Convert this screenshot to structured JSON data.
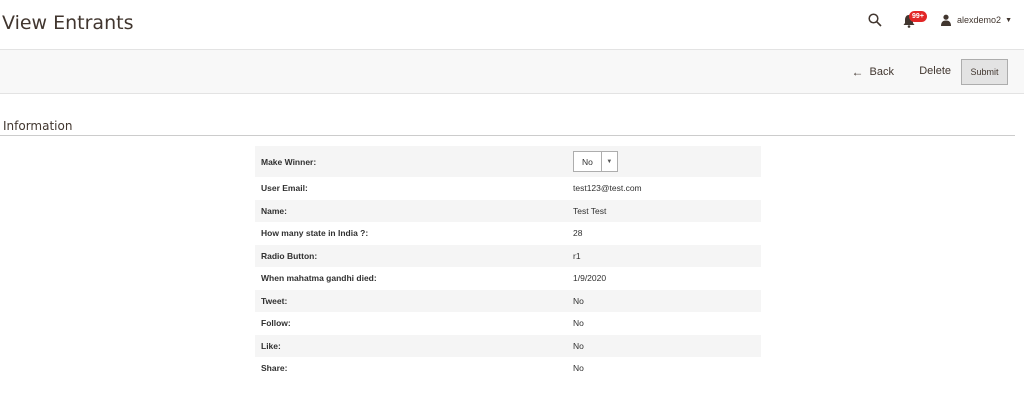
{
  "header": {
    "title": "View Entrants",
    "notification_count": "99+",
    "username": "alexdemo2",
    "icons": [
      "search-icon",
      "bell-icon",
      "user-icon",
      "caret-down-icon"
    ]
  },
  "actions": {
    "back_label": "Back",
    "delete_label": "Delete",
    "submit_label": "Submit"
  },
  "section": {
    "title": "Information"
  },
  "fields": {
    "make_winner": {
      "label": "Make Winner:",
      "value": "No",
      "options_visible": [
        "No"
      ]
    },
    "rows": [
      {
        "label": "User Email:",
        "value": "test123@test.com"
      },
      {
        "label": "Name:",
        "value": "Test Test"
      },
      {
        "label": "How many state in India ?:",
        "value": "28"
      },
      {
        "label": "Radio Button:",
        "value": "r1"
      },
      {
        "label": "When mahatma gandhi died:",
        "value": "1/9/2020"
      },
      {
        "label": "Tweet:",
        "value": "No"
      },
      {
        "label": "Follow:",
        "value": "No"
      },
      {
        "label": "Like:",
        "value": "No"
      },
      {
        "label": "Share:",
        "value": "No"
      }
    ]
  },
  "colors": {
    "badge": "#e22626",
    "stripe": "#f5f5f5",
    "actions_bar": "#f8f8f8"
  }
}
